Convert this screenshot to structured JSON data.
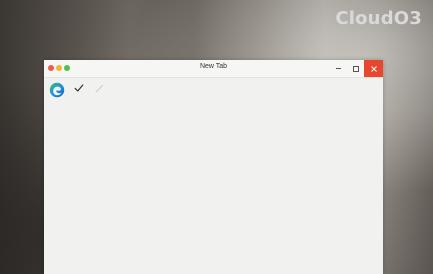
{
  "watermark": {
    "text": "CloudO3"
  },
  "window": {
    "title": "New Tab",
    "close_glyph": "✕"
  },
  "toolbar": {
    "icons": [
      "edge-browser-icon",
      "checkmark-icon",
      "pen-icon"
    ]
  },
  "colors": {
    "close_button": "#e8472f",
    "traffic_red": "#ef5a4f",
    "traffic_yellow": "#f2b72f",
    "traffic_green": "#4fc14a",
    "edge_blue": "#1f8ee0",
    "edge_green": "#3fbf6f"
  }
}
